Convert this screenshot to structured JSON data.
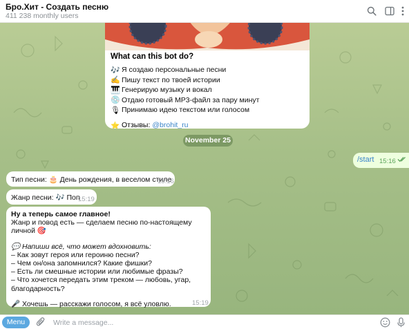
{
  "header": {
    "title": "Бро.Хит - Создать песню",
    "subtitle": "411 238 monthly users",
    "icons": [
      "search-icon",
      "sidebar-toggle-icon",
      "more-vertical-icon"
    ]
  },
  "bot_info": {
    "question": "What can this bot do?",
    "features": [
      {
        "emoji": "🎶",
        "text": "Я создаю персональные песни"
      },
      {
        "emoji": "✍️",
        "text": "Пишу текст по твоей истории"
      },
      {
        "emoji": "🎹",
        "text": "Генерирую музыку и вокал"
      },
      {
        "emoji": "💿",
        "text": "Отдаю готовый MP3-файл за пару минут"
      },
      {
        "emoji": "🎙",
        "text": "Принимаю идею текстом или голосом"
      }
    ],
    "reviews_emoji": "⭐",
    "reviews_label": "Отзывы:",
    "reviews_link": "@brohit_ru"
  },
  "date_separator": "November 25",
  "outgoing": {
    "text": "/start",
    "time": "15:16"
  },
  "messages": [
    {
      "text": "Тип песни: 🎂 День рождения, в веселом стиле",
      "time": "15:16"
    },
    {
      "text": "Жанр песни: 🎶 Поп",
      "time": "15:19"
    }
  ],
  "final_message": {
    "heading": "Ну а теперь самое главное!",
    "line2": "Жанр и повод есть — сделаем песню по-настоящему личной 🎯",
    "hint": "💬 Напиши всё, что может вдохновить:",
    "bullets": [
      "– Как зовут героя или героиню песни?",
      "– Чем он/она запомнился? Какие фишки?",
      "– Есть ли смешные истории или любимые фразы?",
      "– Что хочется передать этим треком — любовь, угар,",
      "благодарность?"
    ],
    "closing": "🎤 Хочешь — расскажи голосом, я всё уловлю.",
    "time": "15:19"
  },
  "composer": {
    "menu_label": "Menu",
    "placeholder": "Write a message...",
    "icons": [
      "attach-icon",
      "emoji-icon",
      "microphone-icon"
    ]
  },
  "colors": {
    "accent": "#5ba8e0",
    "link": "#3a84c9",
    "outgoing_bubble": "#eeffde",
    "chat_background": "#a9c18c"
  }
}
